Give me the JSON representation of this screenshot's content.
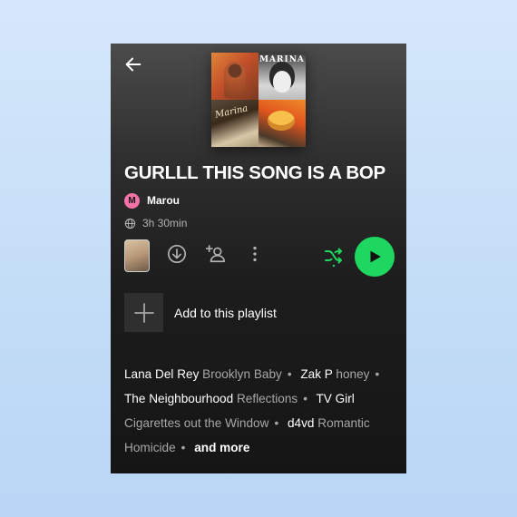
{
  "playlist": {
    "title": "GURLLL THIS SONG IS A BOP",
    "owner": {
      "initial": "M",
      "name": "Marou"
    },
    "duration": "3h 30min",
    "cover_tiles": [
      {
        "text": ""
      },
      {
        "text": "MARINA"
      },
      {
        "text": "Marina"
      },
      {
        "text": ""
      }
    ]
  },
  "actions": {
    "add_to_playlist_label": "Add to this playlist"
  },
  "featured": [
    {
      "artist": "Lana Del Rey",
      "song": "Brooklyn Baby"
    },
    {
      "artist": "Zak P",
      "song": "honey"
    },
    {
      "artist": "The Neighbourhood",
      "song": "Reflections"
    },
    {
      "artist": "TV Girl",
      "song": "Cigarettes out the Window"
    },
    {
      "artist": "d4vd",
      "song": "Romantic Homicide"
    }
  ],
  "more_label": "and more",
  "colors": {
    "accent": "#1ed760",
    "avatar": "#f472a6",
    "background": "#121212"
  },
  "icons": [
    "back-arrow-icon",
    "globe-icon",
    "download-icon",
    "add-collaborator-icon",
    "more-options-icon",
    "shuffle-icon",
    "play-icon",
    "plus-icon"
  ]
}
